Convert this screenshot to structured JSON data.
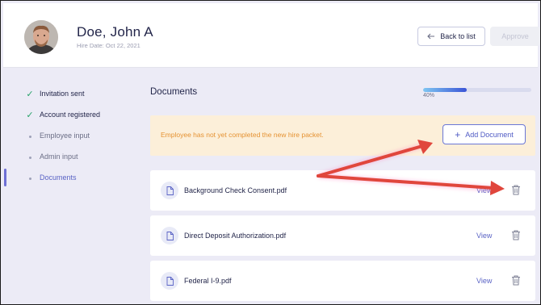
{
  "header": {
    "name": "Doe, John A",
    "hire_date": "Hire Date: Oct 22, 2021",
    "back_label": "Back to list",
    "approve_label": "Approve",
    "avatar_icon": "employee-photo"
  },
  "sidebar": {
    "steps": [
      {
        "label": "Invitation sent",
        "status": "done"
      },
      {
        "label": "Account registered",
        "status": "done"
      },
      {
        "label": "Employee input",
        "status": "pending"
      },
      {
        "label": "Admin input",
        "status": "pending"
      },
      {
        "label": "Documents",
        "status": "active"
      }
    ]
  },
  "main": {
    "title": "Documents",
    "progress": {
      "value": 0.4,
      "label": "40%"
    },
    "alert": {
      "message": "Employee has not yet completed the new hire packet.",
      "add_label": "Add Document"
    },
    "documents": [
      {
        "name": "Background Check Consent.pdf",
        "action": "View"
      },
      {
        "name": "Direct Deposit Authorization.pdf",
        "action": "View"
      },
      {
        "name": "Federal I-9.pdf",
        "action": "View"
      }
    ]
  },
  "colors": {
    "accent": "#5a63c5",
    "success": "#29a36a",
    "warning_bg": "#fcefd9",
    "warning_text": "#e59232",
    "annotation_arrow": "#e0463c"
  }
}
